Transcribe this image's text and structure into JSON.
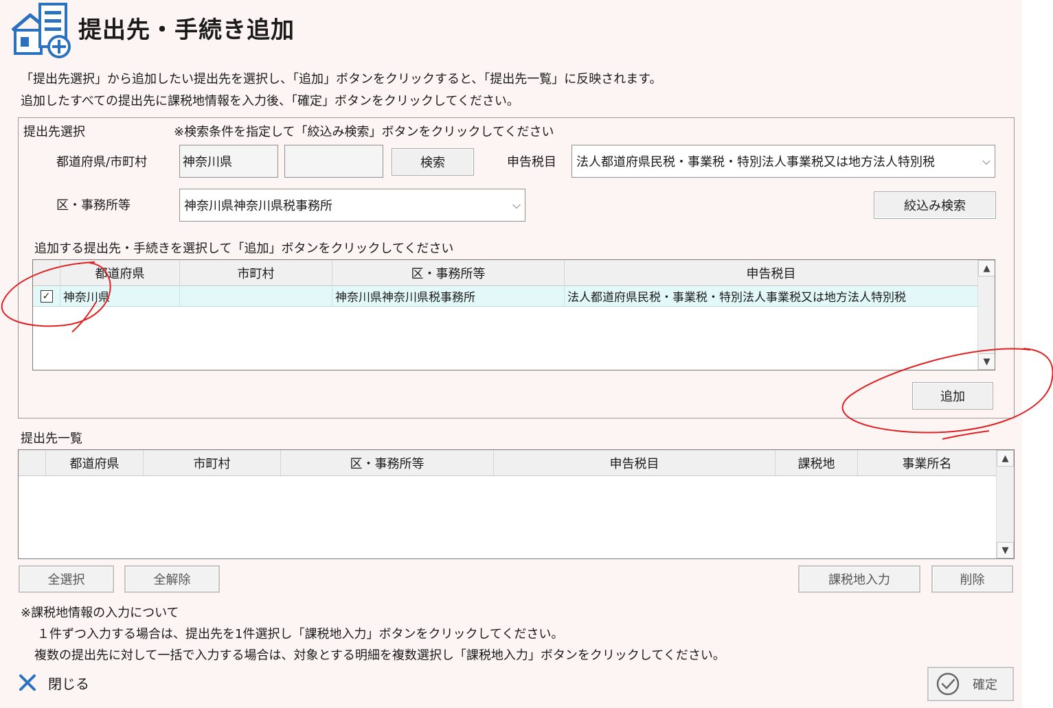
{
  "header": {
    "title": "提出先・手続き追加",
    "icon": "building-add-icon"
  },
  "instructions": {
    "line1": "「提出先選択」から追加したい提出先を選択し、「追加」ボタンをクリックすると、「提出先一覧」に反映されます。",
    "line2": "追加したすべての提出先に課税地情報を入力後、「確定」ボタンをクリックしてください。"
  },
  "selection": {
    "group_label": "提出先選択",
    "search_hint": "※検索条件を指定して「絞込み検索」ボタンをクリックしてください",
    "pref_city_label": "都道府県/市町村",
    "prefecture_value": "神奈川県",
    "city_value": "",
    "search_button": "検索",
    "tax_item_label": "申告税目",
    "tax_item_value": "法人都道府県民税・事業税・特別法人事業税又は地方法人特別税",
    "office_label": "区・事務所等",
    "office_value": "神奈川県神奈川県税事務所",
    "filter_button": "絞込み検索",
    "grid_hint": "追加する提出先・手続きを選択して「追加」ボタンをクリックしてください",
    "columns": [
      "都道府県",
      "市町村",
      "区・事務所等",
      "申告税目"
    ],
    "rows": [
      {
        "checked": true,
        "prefecture": "神奈川県",
        "city": "",
        "office": "神奈川県神奈川県税事務所",
        "tax_item": "法人都道府県民税・事業税・特別法人事業税又は地方法人特別税"
      }
    ],
    "add_button": "追加"
  },
  "list": {
    "label": "提出先一覧",
    "columns": [
      "都道府県",
      "市町村",
      "区・事務所等",
      "申告税目",
      "課税地",
      "事業所名"
    ],
    "rows": []
  },
  "buttons": {
    "select_all": "全選択",
    "deselect_all": "全解除",
    "tax_place_input": "課税地入力",
    "delete": "削除",
    "close": "閉じる",
    "confirm": "確定"
  },
  "notes": {
    "heading": "※課税地情報の入力について",
    "line1": "１件ずつ入力する場合は、提出先を1件選択し「課税地入力」ボタンをクリックしてください。",
    "line2": "複数の提出先に対して一括で入力する場合は、対象とする明細を複数選択し「課税地入力」ボタンをクリックしてください。"
  },
  "colors": {
    "accent": "#2a72c0",
    "annotation": "#e02020",
    "selected_row": "#e3f8f8",
    "background": "#fdf5f4"
  }
}
